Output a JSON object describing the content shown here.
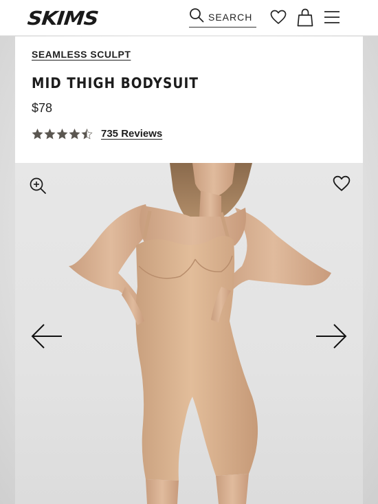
{
  "header": {
    "logo": "SKIMS",
    "search_label": "SEARCH",
    "icons": [
      "search-icon",
      "heart-icon",
      "bag-icon",
      "menu-icon"
    ]
  },
  "product": {
    "collection": "SEAMLESS SCULPT",
    "name": "MID THIGH BODYSUIT",
    "price": "$78",
    "rating_value": 4.5,
    "rating_max": 5,
    "reviews_label": "735 Reviews"
  },
  "gallery": {
    "icons": [
      "zoom-in-icon",
      "heart-icon",
      "arrow-left-icon",
      "arrow-right-icon"
    ]
  },
  "colors": {
    "star": "#5a5650",
    "text": "#1c1c1c",
    "garment": "#d9b08e"
  }
}
